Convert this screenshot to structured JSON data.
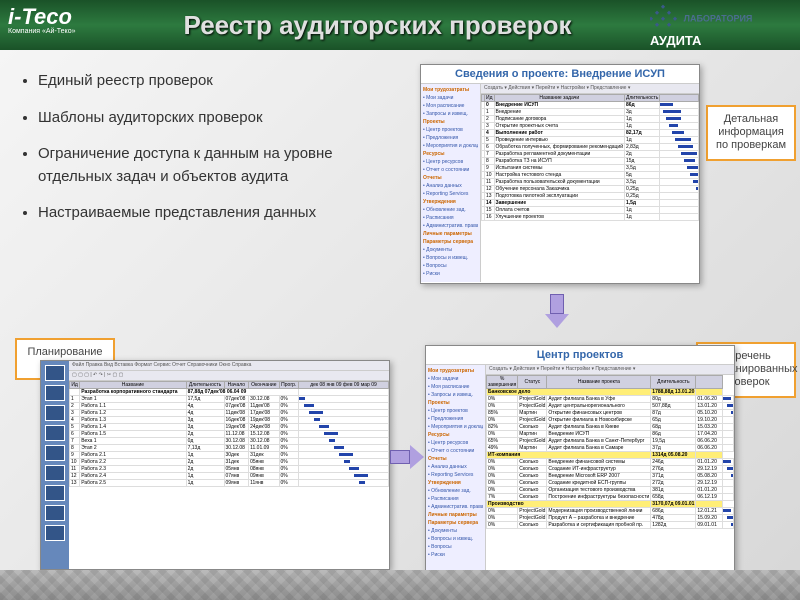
{
  "header": {
    "title": "Реестр аудиторских проверок",
    "logo_company": "i-Teco",
    "logo_subtitle": "Компания «Ай-Теко»",
    "lab_top": "ЛАБОРАТОРИЯ",
    "lab_bottom": "АУДИТА"
  },
  "bullets": [
    "Единый реестр проверок",
    "Шаблоны аудиторских проверок",
    "Ограничение доступа к данным на уровне отдельных задач и объектов аудита",
    "Настраиваемые представления данных"
  ],
  "callouts": {
    "c1": "Детальная информация по проверкам",
    "c2": "Планирование аудита",
    "c3": "Перечень запланированных проверок"
  },
  "shot1": {
    "title": "Сведения о проекте: Внедрение ИСУП",
    "subtitle": "Сведения о проекте",
    "toolbar": "Создать ▾   Действия ▾   Перейти ▾   Настройки ▾   Представление ▾",
    "sidebar": {
      "groups": [
        {
          "hdr": "Мои трудозатраты",
          "items": [
            "Мои задачи",
            "Моя расписание",
            "Запросы и извещ."
          ]
        },
        {
          "hdr": "Проекты",
          "items": [
            "Центр проектов",
            "Предложения",
            "Мероприятия и доклады"
          ]
        },
        {
          "hdr": "Ресурсы",
          "items": [
            "Центр ресурсов",
            "Отчет о состоянии"
          ]
        },
        {
          "hdr": "Отчеты",
          "items": [
            "Анализ данных",
            "Reporting Services"
          ]
        },
        {
          "hdr": "Утверждения",
          "items": [
            "Обновление зад.",
            "Расписания",
            "Административ. права"
          ]
        },
        {
          "hdr": "Личные параметры",
          "items": []
        },
        {
          "hdr": "Параметры сервера",
          "items": [
            "Документы",
            "Вопросы и извещ.",
            "Вопросы",
            "Риски"
          ]
        }
      ]
    },
    "cols": [
      "",
      "Ид",
      "Название задачи",
      "Длительность"
    ],
    "rows": [
      [
        "0",
        "Внедрение ИСУП",
        "86д"
      ],
      [
        "1",
        "Внедрение",
        "3д"
      ],
      [
        "2",
        "Подписание договора",
        "1д"
      ],
      [
        "3",
        "Открытие проектных счета",
        "1д"
      ],
      [
        "4",
        "Выполнение работ",
        "82,17д"
      ],
      [
        "5",
        "Проведение интервью",
        "1д"
      ],
      [
        "6",
        "Обработка полученных, формирование рекомендаций",
        "2,83д"
      ],
      [
        "7",
        "Разработка регламентной документации",
        "2д"
      ],
      [
        "8",
        "Разработка ТЗ на ИСУП",
        "15д"
      ],
      [
        "9",
        "Испытания системы",
        "3,5д"
      ],
      [
        "10",
        "Настройка тестового стенда",
        "5д"
      ],
      [
        "11",
        "Разработка пользовательской документации",
        "3,5д"
      ],
      [
        "12",
        "Обучение персонала Заказчика",
        "0,25д"
      ],
      [
        "13",
        "Подготовка пилотной эксплуатации",
        "0,25д"
      ],
      [
        "14",
        "Завершение",
        "1,5д"
      ],
      [
        "15",
        "Оплата счетов",
        "1д"
      ],
      [
        "16",
        "Улучшение проектов",
        "1д"
      ]
    ]
  },
  "shot2": {
    "toolbar_items": [
      "Файл",
      "Правка",
      "Вид",
      "Вставка",
      "Формат",
      "Сервис",
      "Отчет",
      "Справочники",
      "Окно",
      "Справка"
    ],
    "cols": [
      "Ид",
      "Название",
      "Длительность",
      "Начало",
      "Окончание",
      "Прогр."
    ],
    "header_task": "Разработка корпоративного стандарта",
    "header_dur": "87,88д 07дек'08 06.04 09",
    "rows": [
      [
        "1",
        "Этап 1",
        "17,5д",
        "07дек'08",
        "30.12.08",
        "0%"
      ],
      [
        "2",
        "Работа 1.1",
        "4д",
        "07дек'08",
        "11дек'08",
        "0%"
      ],
      [
        "3",
        "Работа 1.2",
        "4д",
        "11дек'08",
        "17дек'08",
        "0%"
      ],
      [
        "4",
        "Работа 1.3",
        "3д",
        "16дек'08",
        "19дек'08",
        "0%"
      ],
      [
        "5",
        "Работа 1.4",
        "3д",
        "19дек'08",
        "24дек'08",
        "0%"
      ],
      [
        "6",
        "Работа 1.5",
        "2д",
        "11.12.08",
        "15.12.08",
        "0%"
      ],
      [
        "7",
        "Веха 1",
        "0д",
        "30.12.08",
        "30.12.08",
        "0%"
      ],
      [
        "8",
        "Этап 2",
        "7,13д",
        "30.12.08",
        "11.01.09",
        "0%"
      ],
      [
        "9",
        "Работа 2.1",
        "1д",
        "30дек",
        "31дек",
        "0%"
      ],
      [
        "10",
        "Работа 2.2",
        "2д",
        "31дек",
        "05янв",
        "0%"
      ],
      [
        "11",
        "Работа 2.3",
        "2д",
        "05янв",
        "08янв",
        "0%"
      ],
      [
        "12",
        "Работа 2.4",
        "1д",
        "07янв",
        "09янв",
        "0%"
      ],
      [
        "13",
        "Работа 2.5",
        "1д",
        "09янв",
        "11янв",
        "0%"
      ]
    ]
  },
  "shot3": {
    "title": "Центр проектов",
    "toolbar": "Создать ▾   Действия ▾   Перейти ▾   Настройки ▾   Представление ▾",
    "cols": [
      "% завершения",
      "Статус",
      "Название проекта",
      "Длительность"
    ],
    "groups": [
      {
        "name": "Банковское дело",
        "dur": "1788,88д 13.01.20"
      },
      {
        "name": "ИТ-компания",
        "dur": "1314д 05.08.20"
      },
      {
        "name": "Производство",
        "dur": "3170,07д 09.01.01"
      }
    ],
    "rows1": [
      [
        "0%",
        "ProjectGold",
        "Аудит филиала Банка в Уфе",
        "80д",
        "01.06.20"
      ],
      [
        "0%",
        "ProjectGold",
        "Аудит центральнорегионального",
        "507,88д",
        "13.01.20"
      ],
      [
        "85%",
        "Мартин",
        "Открытие финансовых центров",
        "87д",
        "05.10.20"
      ],
      [
        "0%",
        "ProjectGold",
        "Открытие филиала в Новосибирске",
        "65д",
        "19.10.20"
      ],
      [
        "82%",
        "Сколько",
        "Аудит филиала Банка в Киеве",
        "68д",
        "15.03.20"
      ],
      [
        "0%",
        "Мартин",
        "Внедрение ИСУП",
        "86д",
        "17.04.20"
      ],
      [
        "65%",
        "ProjectGold",
        "Аудит филиала Банка в Санкт-Петербург",
        "19,5д",
        "06.06.20"
      ],
      [
        "49%",
        "Мартин",
        "Аудит филиала Банка в Самаре",
        "37д",
        "06.06.20"
      ]
    ],
    "rows2": [
      [
        "0%",
        "Сколько",
        "Внедрение финансовой системы",
        "246д",
        "01.01.20"
      ],
      [
        "0%",
        "Сколько",
        "Создание ИТ-инфраструктур",
        "276д",
        "29.12.19"
      ],
      [
        "0%",
        "Сколько",
        "Внедрение Microsoft ERP 2007",
        "371д",
        "05.08.20"
      ],
      [
        "0%",
        "Сколько",
        "Создание кредитной ЕСП-группы",
        "272д",
        "29.12.19"
      ],
      [
        "0%",
        "Сколько",
        "Организация тестового производства",
        "381д",
        "01.01.20"
      ],
      [
        "7%",
        "Сколько",
        "Построение инфраструктуры безопасности",
        "658д",
        "06.12.19"
      ]
    ],
    "rows3": [
      [
        "0%",
        "ProjectGold",
        "Модернизация производственной линии",
        "686д",
        "12.01.21"
      ],
      [
        "0%",
        "ProjectGold",
        "Продукт А – разработка и внедрение",
        "478д",
        "15.09.20"
      ],
      [
        "0%",
        "Сколько",
        "Разработка и сертификация пробной пр.",
        "1282д",
        "09.01.01"
      ]
    ]
  }
}
